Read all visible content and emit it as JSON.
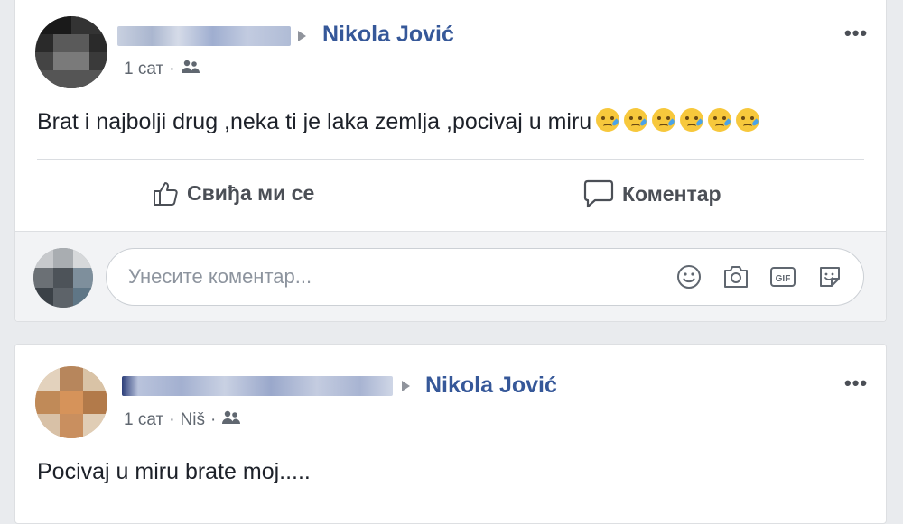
{
  "post1": {
    "target_name": "Nikola Jović",
    "time": "1 сат",
    "text": "Brat i najbolji drug ,neka ti je laka zemlja ,pocivaj u miru",
    "emoji_count": 6,
    "like_label": "Свиђа ми се",
    "comment_label": "Коментар",
    "comment_placeholder": "Унесите коментар...",
    "more": "•••"
  },
  "post2": {
    "target_name": "Nikola Jović",
    "time": "1 сат",
    "location": "Niš",
    "text": "Pocivaj u miru brate moj.....",
    "more": "•••"
  },
  "colors": {
    "link": "#365899",
    "background": "#e9ebee"
  }
}
